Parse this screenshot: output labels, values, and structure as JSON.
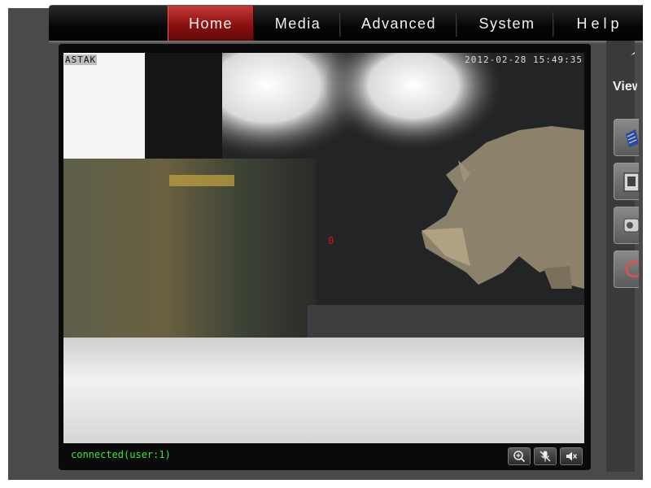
{
  "nav": {
    "items": [
      {
        "label": "Home",
        "active": true
      },
      {
        "label": "Media",
        "active": false
      },
      {
        "label": "Advanced",
        "active": false
      },
      {
        "label": "System",
        "active": false
      },
      {
        "label": "Help",
        "active": false
      }
    ]
  },
  "video": {
    "camera_label": "ASTAK",
    "timestamp": "2012-02-28 15:49:35",
    "crosshair": "0"
  },
  "status": {
    "text": "connected(user:1)"
  },
  "controls": {
    "icons": [
      "zoom-in-icon",
      "microphone-mute-icon",
      "speaker-mute-icon"
    ]
  },
  "side": {
    "view_label": "View",
    "buttons": [
      "video-clip-icon",
      "snapshot-icon",
      "record-icon",
      "power-icon"
    ]
  },
  "colors": {
    "active_tab": "#8a1010",
    "status_text": "#3ee43e",
    "crosshair": "#e01010"
  }
}
